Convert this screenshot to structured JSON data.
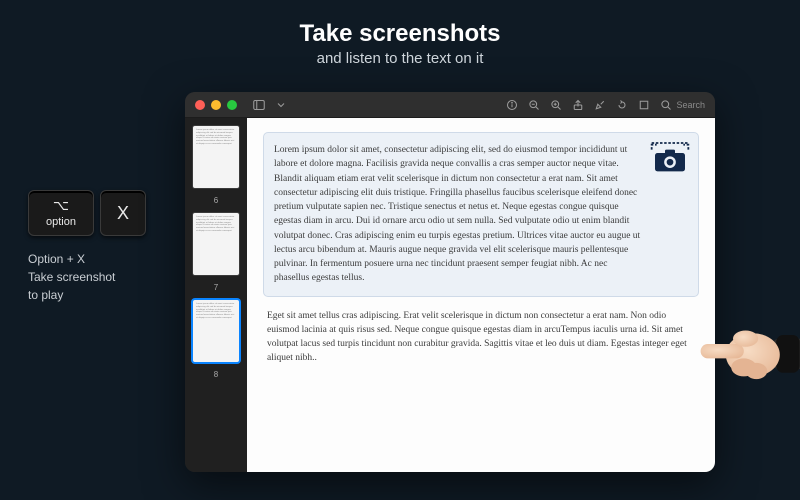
{
  "hero": {
    "title": "Take screenshots",
    "subtitle": "and listen to the text on it"
  },
  "shortcut": {
    "key1_glyph": "⌥",
    "key1_label": "option",
    "key2_label": "X",
    "caption_line1": "Option + X",
    "caption_line2": "Take screenshot",
    "caption_line3": "to play"
  },
  "toolbar": {
    "search_placeholder": "Search"
  },
  "sidebar": {
    "thumbs": [
      {
        "num": "6"
      },
      {
        "num": "7"
      },
      {
        "num": "8",
        "active": true
      }
    ]
  },
  "doc": {
    "p1": "Lorem ipsum dolor sit amet, consectetur adipiscing elit, sed do eiusmod tempor incididunt ut labore et dolore magna. Facilisis gravida neque convallis a cras semper auctor neque vitae. Blandit aliquam etiam erat velit scelerisque in dictum non consectetur a erat nam. Sit amet consectetur adipiscing elit duis tristique. Fringilla phasellus faucibus scelerisque eleifend donec pretium vulputate sapien nec. Tristique senectus et netus et. Neque egestas congue quisque egestas diam in arcu. Dui id ornare arcu odio ut sem nulla. Sed vulputate odio ut enim blandit volutpat donec. Cras adipiscing enim eu turpis egestas pretium. Ultrices vitae auctor eu augue ut lectus arcu bibendum at. Mauris augue neque gravida vel elit scelerisque mauris pellentesque pulvinar. In fermentum posuere urna nec tincidunt praesent semper feugiat nibh. Ac nec phasellus egestas tellus.",
    "p2": "Eget sit amet tellus cras adipiscing. Erat velit scelerisque in dictum non consectetur a erat nam. Non odio euismod lacinia at quis risus sed. Neque congue quisque egestas diam in arcuTempus iaculis urna id. Sit amet volutpat lacus sed turpis tincidunt non curabitur gravida. Sagittis vitae et leo duis ut diam. Egestas integer eget aliquet nibh.."
  }
}
